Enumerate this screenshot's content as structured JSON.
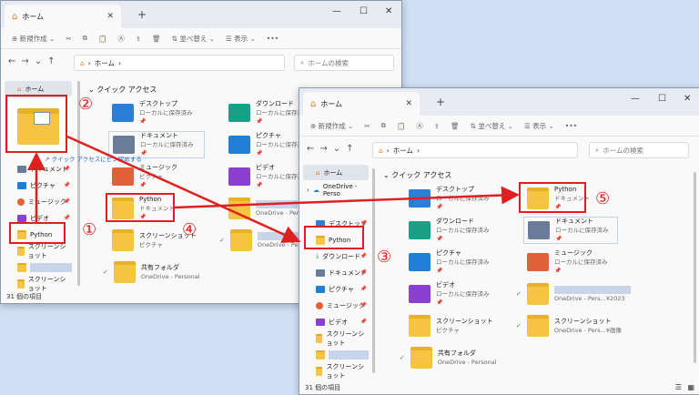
{
  "win_back": {
    "tab": "ホーム",
    "toolbar": {
      "new": "新規作成",
      "sort": "並べ替え",
      "view": "表示",
      "more": "•••"
    },
    "path": "ホーム",
    "search": "ホームの検索",
    "sidebar": [
      {
        "label": "ホーム",
        "icon": "home-icon"
      },
      {
        "label": "ドキュメント",
        "icon": "document-icon"
      },
      {
        "label": "ピクチャ",
        "icon": "picture-icon"
      },
      {
        "label": "ミュージック",
        "icon": "music-icon"
      },
      {
        "label": "ビデオ",
        "icon": "video-icon"
      },
      {
        "label": "Python",
        "icon": "folder-icon"
      },
      {
        "label": "スクリーンショット",
        "icon": "folder-icon"
      },
      {
        "label": "",
        "icon": "folder-icon"
      },
      {
        "label": "スクリーンショット",
        "icon": "folder-icon"
      }
    ],
    "section": "クイック アクセス",
    "items": [
      {
        "name": "デスクトップ",
        "sub": "ローカルに保存済み"
      },
      {
        "name": "ダウンロード",
        "sub": "ローカルに保存済み"
      },
      {
        "name": "ドキュメント",
        "sub": "ローカルに保存済み"
      },
      {
        "name": "ピクチャ",
        "sub": "ローカルに保存済み"
      },
      {
        "name": "ミュージック",
        "sub": "ピクチャ"
      },
      {
        "name": "ビデオ",
        "sub": "ローカルに保存済み"
      },
      {
        "name": "Python",
        "sub": "ドキュメント"
      },
      {
        "name": "",
        "sub": "OneDrive - Perso"
      },
      {
        "name": "スクリーンショット",
        "sub": "ピクチャ"
      },
      {
        "name": "",
        "sub": "OneDrive - Perso"
      },
      {
        "name": "共有フォルダ",
        "sub": "OneDrive - Personal"
      }
    ],
    "drag_label": "クイック アクセスにピン留めする",
    "status": "31 個の項目"
  },
  "win_front": {
    "tab": "ホーム",
    "toolbar": {
      "new": "新規作成",
      "sort": "並べ替え",
      "view": "表示",
      "more": "•••"
    },
    "path": "ホーム",
    "search": "ホームの検索",
    "sidebar": [
      {
        "label": "ホーム",
        "icon": "home-icon"
      },
      {
        "label": "OneDrive - Perso",
        "icon": "cloud-icon"
      },
      {
        "label": "デスクトップ",
        "icon": "desktop-icon"
      },
      {
        "label": "Python",
        "icon": "folder-icon"
      },
      {
        "label": "ダウンロード",
        "icon": "download-icon"
      },
      {
        "label": "ドキュメント",
        "icon": "document-icon"
      },
      {
        "label": "ピクチャ",
        "icon": "picture-icon"
      },
      {
        "label": "ミュージック",
        "icon": "music-icon"
      },
      {
        "label": "ビデオ",
        "icon": "video-icon"
      },
      {
        "label": "スクリーンショット",
        "icon": "folder-icon"
      },
      {
        "label": "",
        "icon": "folder-icon"
      },
      {
        "label": "スクリーンショット",
        "icon": "folder-icon"
      }
    ],
    "section": "クイック アクセス",
    "items": [
      {
        "name": "デスクトップ",
        "sub": "ローカルに保存済み"
      },
      {
        "name": "Python",
        "sub": "ドキュメント"
      },
      {
        "name": "ダウンロード",
        "sub": "ローカルに保存済み"
      },
      {
        "name": "ドキュメント",
        "sub": "ローカルに保存済み"
      },
      {
        "name": "ピクチャ",
        "sub": "ローカルに保存済み"
      },
      {
        "name": "ミュージック",
        "sub": "ローカルに保存済み"
      },
      {
        "name": "ビデオ",
        "sub": "ローカルに保存済み"
      },
      {
        "name": "",
        "sub": "OneDrive - Pers...¥2023"
      },
      {
        "name": "スクリーンショット",
        "sub": "ピクチャ"
      },
      {
        "name": "スクリーンショット",
        "sub": "OneDrive - Pers...¥画像"
      },
      {
        "name": "共有フォルダ",
        "sub": "OneDrive - Personal"
      }
    ],
    "status": "31 個の項目"
  },
  "annotations": {
    "n1": "①",
    "n2": "②",
    "n3": "③",
    "n4": "④",
    "n5": "⑤"
  },
  "colors": {
    "annotation": "#e02020",
    "folder": "#f5c542"
  }
}
